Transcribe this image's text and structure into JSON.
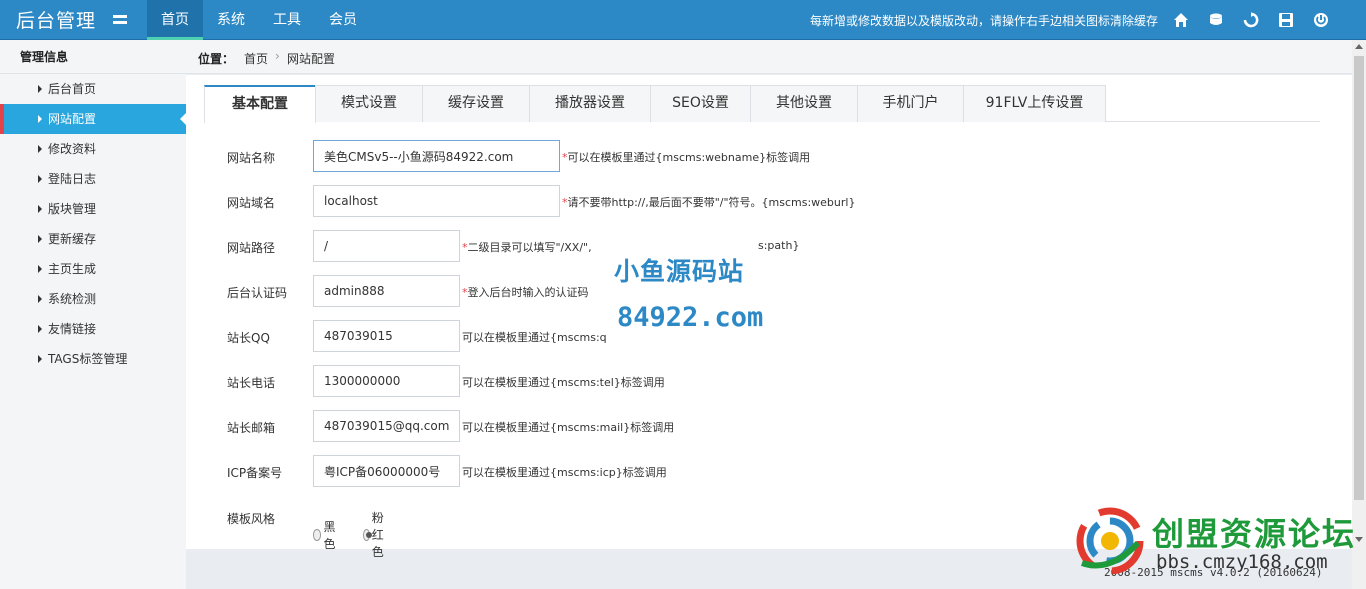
{
  "app": {
    "title": "后台管理",
    "nav": [
      "首页",
      "系统",
      "工具",
      "会员"
    ],
    "nav_active": "首页",
    "notice": "每新增或修改数据以及模版改动，请操作右手边相关图标清除缓存",
    "top_icons": [
      "home-icon",
      "database-icon",
      "refresh-icon",
      "save-icon",
      "power-icon"
    ]
  },
  "sidebar": {
    "heading": "管理信息",
    "items": [
      {
        "label": "后台首页"
      },
      {
        "label": "网站配置",
        "active": true
      },
      {
        "label": "修改资料"
      },
      {
        "label": "登陆日志"
      },
      {
        "label": "版块管理"
      },
      {
        "label": "更新缓存"
      },
      {
        "label": "主页生成"
      },
      {
        "label": "系统检测"
      },
      {
        "label": "友情链接"
      },
      {
        "label": "TAGS标签管理"
      }
    ]
  },
  "breadcrumb": {
    "label": "位置：",
    "home": "首页",
    "separator": "›",
    "current": "网站配置"
  },
  "tabs": [
    "基本配置",
    "模式设置",
    "缓存设置",
    "播放器设置",
    "SEO设置",
    "其他设置",
    "手机门户",
    "91FLV上传设置"
  ],
  "tab_active": "基本配置",
  "form": {
    "site_name": {
      "label": "网站名称",
      "value": "美色CMSv5--小鱼源码84922.com",
      "hint_star": "*",
      "hint": "可以在模板里通过{mscms:webname}标签调用"
    },
    "site_domain": {
      "label": "网站域名",
      "value": "localhost",
      "hint_star": "*",
      "hint": "请不要带http://,最后面不要带\"/\"符号。{mscms:weburl}"
    },
    "site_path": {
      "label": "网站路径",
      "value": "/",
      "hint_star": "*",
      "hint": "二级目录可以填写\"/XX/\",",
      "hint_tail": "s:path}"
    },
    "admin_code": {
      "label": "后台认证码",
      "value": "admin888",
      "hint_star": "*",
      "hint": "登入后台时输入的认证码"
    },
    "qq": {
      "label": "站长QQ",
      "value": "487039015",
      "hint": "可以在模板里通过{mscms:q"
    },
    "phone": {
      "label": "站长电话",
      "value": "1300000000",
      "hint": "可以在模板里通过{mscms:tel}标签调用"
    },
    "email": {
      "label": "站长邮箱",
      "value": "487039015@qq.com",
      "hint": "可以在模板里通过{mscms:mail}标签调用"
    },
    "icp": {
      "label": "ICP备案号",
      "value": "粤ICP备06000000号",
      "hint": "可以在模板里通过{mscms:icp}标签调用"
    },
    "theme": {
      "label": "模板风格",
      "options": [
        "黑色",
        "粉红色"
      ],
      "selected": "粉红色"
    }
  },
  "watermark": {
    "line1": "小鱼源码站",
    "line2": "84922.com"
  },
  "forum_logo": {
    "title": "创盟资源论坛",
    "url": "bbs.cmzy168.com"
  },
  "footer": "2008-2015  mscms v4.0.2 (20160624)",
  "colors": {
    "topbar": "#2c89c6",
    "sidebar_active": "#29a6dd",
    "active_marker": "#e2434b",
    "required_star": "#e2434b",
    "watermark": "#2c89c6",
    "forum_green": "#1f9a3a"
  }
}
